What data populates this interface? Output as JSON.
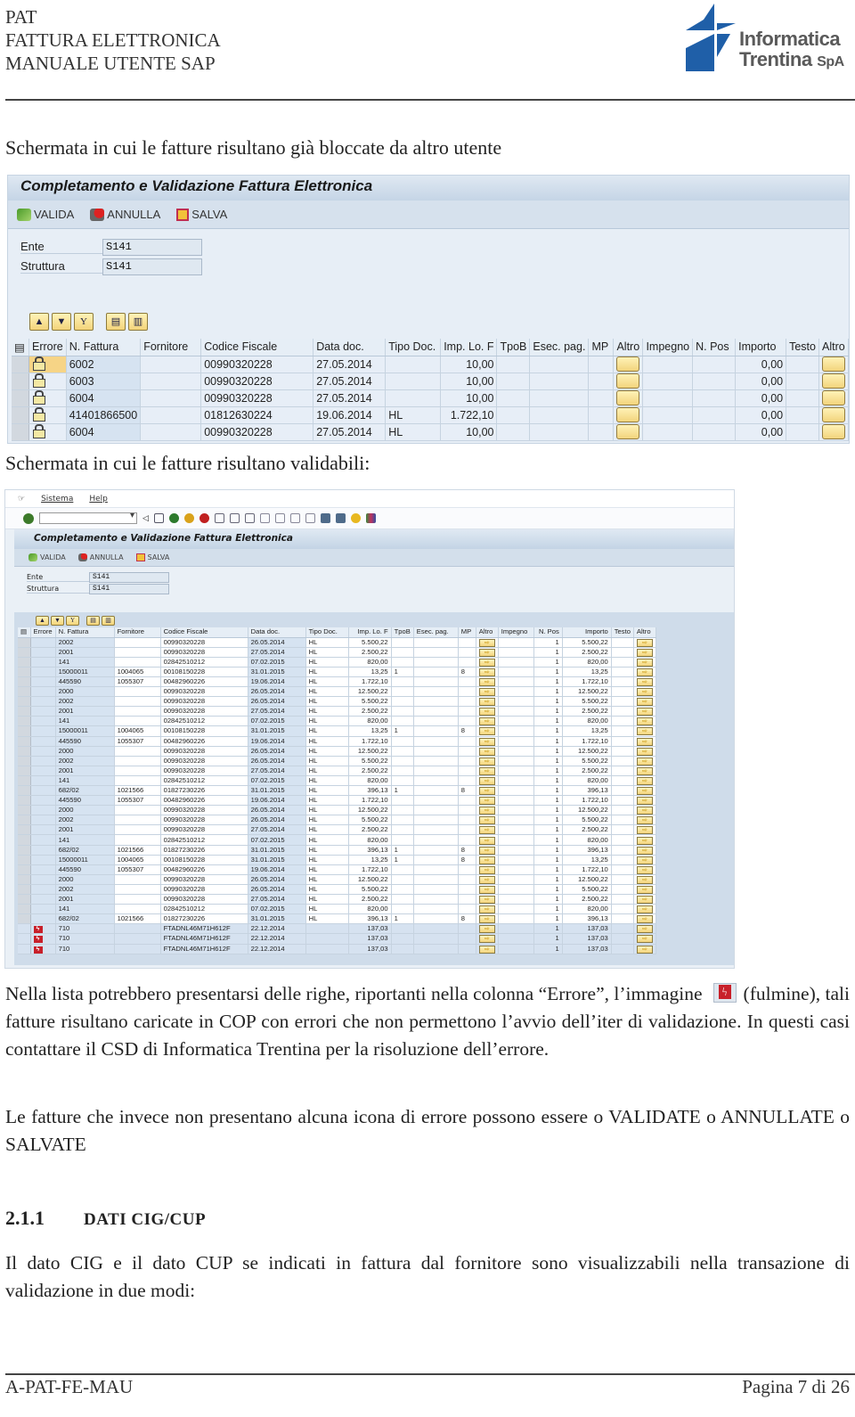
{
  "header": {
    "lines": [
      "PAT",
      "FATTURA ELETTRONICA",
      "MANUALE UTENTE SAP"
    ],
    "logo": {
      "line1": "Informatica",
      "line2": "Trentina",
      "suffix": "SpA",
      "brand_color": "#1f5fa8",
      "text_color": "#5a5a5a"
    }
  },
  "caption1": "Schermata in cui le fatture risultano già bloccate da altro utente",
  "caption2": "Schermata in cui le fatture risultano validabili:",
  "screen1": {
    "title": "Completamento e Validazione Fattura Elettronica",
    "toolbar": {
      "valida": "VALIDA",
      "annulla": "ANNULLA",
      "salva": "SALVA"
    },
    "fields": [
      {
        "label": "Ente",
        "value": "S141"
      },
      {
        "label": "Struttura",
        "value": "S141"
      }
    ],
    "columns": [
      "Errore",
      "N. Fattura",
      "Fornitore",
      "Codice Fiscale",
      "Data doc.",
      "Tipo Doc.",
      "Imp. Lo. F",
      "TpoB",
      "Esec. pag.",
      "MP",
      "Altro",
      "Impegno",
      "N. Pos",
      "Importo",
      "Testo",
      "Altro"
    ],
    "rows": [
      {
        "errore": "lock-icon",
        "fattura": "6002",
        "fornitore": "",
        "cf": "00990320228",
        "data": "27.05.2014",
        "tipo": "",
        "imp": "10,00",
        "importo": "0,00"
      },
      {
        "errore": "lock-icon",
        "fattura": "6003",
        "fornitore": "",
        "cf": "00990320228",
        "data": "27.05.2014",
        "tipo": "",
        "imp": "10,00",
        "importo": "0,00"
      },
      {
        "errore": "lock-icon",
        "fattura": "6004",
        "fornitore": "",
        "cf": "00990320228",
        "data": "27.05.2014",
        "tipo": "",
        "imp": "10,00",
        "importo": "0,00"
      },
      {
        "errore": "lock-icon",
        "fattura": "41401866500",
        "fornitore": "",
        "cf": "01812630224",
        "data": "19.06.2014",
        "tipo": "HL",
        "imp": "1.722,10",
        "importo": "0,00"
      },
      {
        "errore": "lock-icon",
        "fattura": "6004",
        "fornitore": "",
        "cf": "00990320228",
        "data": "27.05.2014",
        "tipo": "HL",
        "imp": "10,00",
        "importo": "0,00"
      }
    ]
  },
  "screen2": {
    "menu": [
      "Sistema",
      "Help"
    ],
    "title": "Completamento e Validazione Fattura Elettronica",
    "toolbar": {
      "valida": "VALIDA",
      "annulla": "ANNULLA",
      "salva": "SALVA"
    },
    "fields": [
      {
        "label": "Ente",
        "value": "S141"
      },
      {
        "label": "Struttura",
        "value": "S141"
      }
    ],
    "columns": [
      "Errore",
      "N. Fattura",
      "Fornitore",
      "Codice Fiscale",
      "Data doc.",
      "Tipo Doc.",
      "Imp. Lo. F",
      "TpoB",
      "Esec. pag.",
      "MP",
      "Altro",
      "Impegno",
      "N. Pos",
      "Importo",
      "Testo",
      "Altro"
    ],
    "rows": [
      {
        "err": false,
        "fattura": "2002",
        "forn": "",
        "cf": "00990320228",
        "data": "26.05.2014",
        "tipo": "HL",
        "imp": "5.500,22",
        "tpob": "",
        "mp": "",
        "npos": "1",
        "importo": "5.500,22"
      },
      {
        "err": false,
        "fattura": "2001",
        "forn": "",
        "cf": "00990320228",
        "data": "27.05.2014",
        "tipo": "HL",
        "imp": "2.500,22",
        "tpob": "",
        "mp": "",
        "npos": "1",
        "importo": "2.500,22"
      },
      {
        "err": false,
        "fattura": "141",
        "forn": "",
        "cf": "02842510212",
        "data": "07.02.2015",
        "tipo": "HL",
        "imp": "820,00",
        "tpob": "",
        "mp": "",
        "npos": "1",
        "importo": "820,00"
      },
      {
        "err": false,
        "fattura": "15000011",
        "forn": "1004065",
        "cf": "00108150228",
        "data": "31.01.2015",
        "tipo": "HL",
        "imp": "13,25",
        "tpob": "1",
        "mp": "8",
        "npos": "1",
        "importo": "13,25"
      },
      {
        "err": false,
        "fattura": "445590",
        "forn": "1055307",
        "cf": "00482960226",
        "data": "19.06.2014",
        "tipo": "HL",
        "imp": "1.722,10",
        "tpob": "",
        "mp": "",
        "npos": "1",
        "importo": "1.722,10"
      },
      {
        "err": false,
        "fattura": "2000",
        "forn": "",
        "cf": "00990320228",
        "data": "26.05.2014",
        "tipo": "HL",
        "imp": "12.500,22",
        "tpob": "",
        "mp": "",
        "npos": "1",
        "importo": "12.500,22"
      },
      {
        "err": false,
        "fattura": "2002",
        "forn": "",
        "cf": "00990320228",
        "data": "26.05.2014",
        "tipo": "HL",
        "imp": "5.500,22",
        "tpob": "",
        "mp": "",
        "npos": "1",
        "importo": "5.500,22"
      },
      {
        "err": false,
        "fattura": "2001",
        "forn": "",
        "cf": "00990320228",
        "data": "27.05.2014",
        "tipo": "HL",
        "imp": "2.500,22",
        "tpob": "",
        "mp": "",
        "npos": "1",
        "importo": "2.500,22"
      },
      {
        "err": false,
        "fattura": "141",
        "forn": "",
        "cf": "02842510212",
        "data": "07.02.2015",
        "tipo": "HL",
        "imp": "820,00",
        "tpob": "",
        "mp": "",
        "npos": "1",
        "importo": "820,00"
      },
      {
        "err": false,
        "fattura": "15000011",
        "forn": "1004065",
        "cf": "00108150228",
        "data": "31.01.2015",
        "tipo": "HL",
        "imp": "13,25",
        "tpob": "1",
        "mp": "8",
        "npos": "1",
        "importo": "13,25"
      },
      {
        "err": false,
        "fattura": "445590",
        "forn": "1055307",
        "cf": "00482960226",
        "data": "19.06.2014",
        "tipo": "HL",
        "imp": "1.722,10",
        "tpob": "",
        "mp": "",
        "npos": "1",
        "importo": "1.722,10"
      },
      {
        "err": false,
        "fattura": "2000",
        "forn": "",
        "cf": "00990320228",
        "data": "26.05.2014",
        "tipo": "HL",
        "imp": "12.500,22",
        "tpob": "",
        "mp": "",
        "npos": "1",
        "importo": "12.500,22"
      },
      {
        "err": false,
        "fattura": "2002",
        "forn": "",
        "cf": "00990320228",
        "data": "26.05.2014",
        "tipo": "HL",
        "imp": "5.500,22",
        "tpob": "",
        "mp": "",
        "npos": "1",
        "importo": "5.500,22"
      },
      {
        "err": false,
        "fattura": "2001",
        "forn": "",
        "cf": "00990320228",
        "data": "27.05.2014",
        "tipo": "HL",
        "imp": "2.500,22",
        "tpob": "",
        "mp": "",
        "npos": "1",
        "importo": "2.500,22"
      },
      {
        "err": false,
        "fattura": "141",
        "forn": "",
        "cf": "02842510212",
        "data": "07.02.2015",
        "tipo": "HL",
        "imp": "820,00",
        "tpob": "",
        "mp": "",
        "npos": "1",
        "importo": "820,00"
      },
      {
        "err": false,
        "fattura": "682/02",
        "forn": "1021566",
        "cf": "01827230226",
        "data": "31.01.2015",
        "tipo": "HL",
        "imp": "396,13",
        "tpob": "1",
        "mp": "8",
        "npos": "1",
        "importo": "396,13"
      },
      {
        "err": false,
        "fattura": "445590",
        "forn": "1055307",
        "cf": "00482960226",
        "data": "19.06.2014",
        "tipo": "HL",
        "imp": "1.722,10",
        "tpob": "",
        "mp": "",
        "npos": "1",
        "importo": "1.722,10"
      },
      {
        "err": false,
        "fattura": "2000",
        "forn": "",
        "cf": "00990320228",
        "data": "26.05.2014",
        "tipo": "HL",
        "imp": "12.500,22",
        "tpob": "",
        "mp": "",
        "npos": "1",
        "importo": "12.500,22"
      },
      {
        "err": false,
        "fattura": "2002",
        "forn": "",
        "cf": "00990320228",
        "data": "26.05.2014",
        "tipo": "HL",
        "imp": "5.500,22",
        "tpob": "",
        "mp": "",
        "npos": "1",
        "importo": "5.500,22"
      },
      {
        "err": false,
        "fattura": "2001",
        "forn": "",
        "cf": "00990320228",
        "data": "27.05.2014",
        "tipo": "HL",
        "imp": "2.500,22",
        "tpob": "",
        "mp": "",
        "npos": "1",
        "importo": "2.500,22"
      },
      {
        "err": false,
        "fattura": "141",
        "forn": "",
        "cf": "02842510212",
        "data": "07.02.2015",
        "tipo": "HL",
        "imp": "820,00",
        "tpob": "",
        "mp": "",
        "npos": "1",
        "importo": "820,00"
      },
      {
        "err": false,
        "fattura": "682/02",
        "forn": "1021566",
        "cf": "01827230226",
        "data": "31.01.2015",
        "tipo": "HL",
        "imp": "396,13",
        "tpob": "1",
        "mp": "8",
        "npos": "1",
        "importo": "396,13"
      },
      {
        "err": false,
        "fattura": "15000011",
        "forn": "1004065",
        "cf": "00108150228",
        "data": "31.01.2015",
        "tipo": "HL",
        "imp": "13,25",
        "tpob": "1",
        "mp": "8",
        "npos": "1",
        "importo": "13,25"
      },
      {
        "err": false,
        "fattura": "445590",
        "forn": "1055307",
        "cf": "00482960226",
        "data": "19.06.2014",
        "tipo": "HL",
        "imp": "1.722,10",
        "tpob": "",
        "mp": "",
        "npos": "1",
        "importo": "1.722,10"
      },
      {
        "err": false,
        "fattura": "2000",
        "forn": "",
        "cf": "00990320228",
        "data": "26.05.2014",
        "tipo": "HL",
        "imp": "12.500,22",
        "tpob": "",
        "mp": "",
        "npos": "1",
        "importo": "12.500,22"
      },
      {
        "err": false,
        "fattura": "2002",
        "forn": "",
        "cf": "00990320228",
        "data": "26.05.2014",
        "tipo": "HL",
        "imp": "5.500,22",
        "tpob": "",
        "mp": "",
        "npos": "1",
        "importo": "5.500,22"
      },
      {
        "err": false,
        "fattura": "2001",
        "forn": "",
        "cf": "00990320228",
        "data": "27.05.2014",
        "tipo": "HL",
        "imp": "2.500,22",
        "tpob": "",
        "mp": "",
        "npos": "1",
        "importo": "2.500,22"
      },
      {
        "err": false,
        "fattura": "141",
        "forn": "",
        "cf": "02842510212",
        "data": "07.02.2015",
        "tipo": "HL",
        "imp": "820,00",
        "tpob": "",
        "mp": "",
        "npos": "1",
        "importo": "820,00"
      },
      {
        "err": false,
        "fattura": "682/02",
        "forn": "1021566",
        "cf": "01827230226",
        "data": "31.01.2015",
        "tipo": "HL",
        "imp": "396,13",
        "tpob": "1",
        "mp": "8",
        "npos": "1",
        "importo": "396,13"
      },
      {
        "err": true,
        "fattura": "710",
        "forn": "",
        "cf": "FTADNL46M71H612F",
        "data": "22.12.2014",
        "tipo": "",
        "imp": "137,03",
        "tpob": "",
        "mp": "",
        "npos": "1",
        "importo": "137,03"
      },
      {
        "err": true,
        "fattura": "710",
        "forn": "",
        "cf": "FTADNL46M71H612F",
        "data": "22.12.2014",
        "tipo": "",
        "imp": "137,03",
        "tpob": "",
        "mp": "",
        "npos": "1",
        "importo": "137,03"
      },
      {
        "err": true,
        "fattura": "710",
        "forn": "",
        "cf": "FTADNL46M71H612F",
        "data": "22.12.2014",
        "tipo": "",
        "imp": "137,03",
        "tpob": "",
        "mp": "",
        "npos": "1",
        "importo": "137,03"
      }
    ]
  },
  "body": {
    "p1_before": "Nella lista potrebbero presentarsi delle righe, riportanti nella colonna “Errore”, l’immagine",
    "p1_after": "(fulmine), tali fatture risultano caricate in COP con errori che non permettono l’avvio dell’iter di validazione. In questi casi contattare il CSD di Informatica Trentina per la risoluzione dell’errore.",
    "p2": "Le fatture che invece non presentano alcuna icona di errore possono essere o VALIDATE o ANNULLATE o SALVATE",
    "section_number": "2.1.1",
    "section_title": "DATI CIG/CUP",
    "p3": "Il dato CIG e il dato CUP se indicati in fattura dal fornitore sono visualizzabili nella transazione di validazione in due modi:"
  },
  "footer": {
    "doc_code": "A-PAT-FE-MAU",
    "page": "Pagina 7 di 26"
  }
}
